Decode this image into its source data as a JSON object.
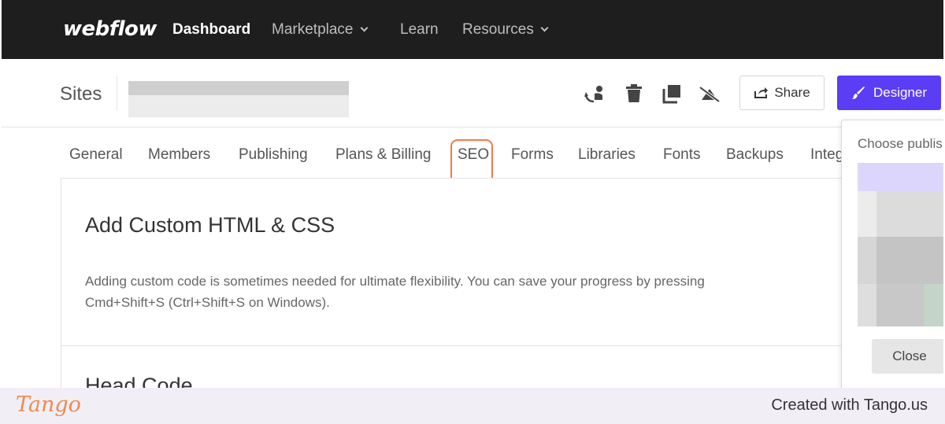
{
  "nav": {
    "logo": "webflow",
    "items": [
      {
        "label": "Dashboard",
        "active": true
      },
      {
        "label": "Marketplace",
        "dropdown": true
      },
      {
        "label": "Learn"
      },
      {
        "label": "Resources",
        "dropdown": true
      }
    ]
  },
  "sitebar": {
    "sites_label": "Sites",
    "tool_icons": [
      "duplicate-site-icon",
      "trash-icon",
      "copy-icon",
      "unpublish-icon"
    ],
    "share_label": "Share",
    "designer_label": "Designer"
  },
  "tabs": [
    {
      "label": "General"
    },
    {
      "label": "Members"
    },
    {
      "label": "Publishing"
    },
    {
      "label": "Plans & Billing"
    },
    {
      "label": "SEO",
      "highlighted": true
    },
    {
      "label": "Forms"
    },
    {
      "label": "Libraries"
    },
    {
      "label": "Fonts"
    },
    {
      "label": "Backups"
    },
    {
      "label": "Integ"
    }
  ],
  "content": {
    "title": "Add Custom HTML & CSS",
    "description": "Adding custom code is sometimes needed for ultimate flexibility. You can save your progress by pressing Cmd+Shift+S (Ctrl+Shift+S on Windows).",
    "section_heading": "Head Code"
  },
  "popover": {
    "title": "Choose publis",
    "close_label": "Close"
  },
  "footer": {
    "logo": "Tango",
    "credit": "Created with Tango.us"
  },
  "colors": {
    "nav_bg": "#1e1e1e",
    "designer_accent": "#5b3df5",
    "highlight": "#f07a4a",
    "footer_bg": "#f1eff5"
  }
}
